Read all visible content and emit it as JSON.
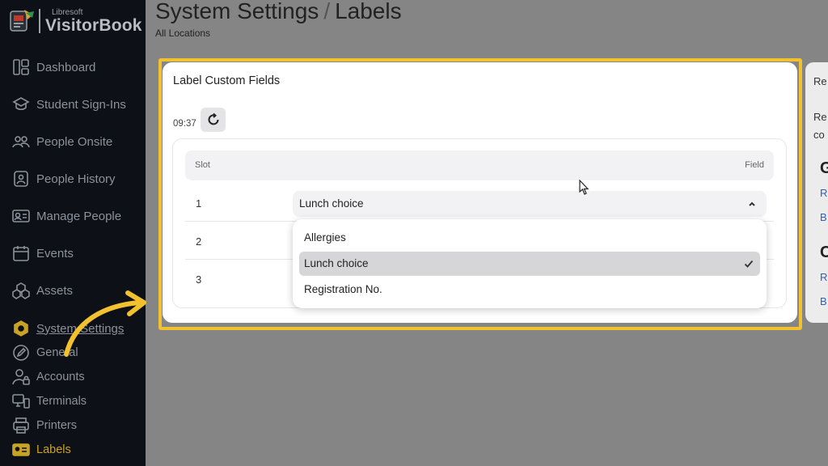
{
  "brand": {
    "small": "Libresoft",
    "name": "VisitorBook"
  },
  "sidebar": {
    "items": [
      {
        "label": "Dashboard",
        "icon": "dashboard-icon"
      },
      {
        "label": "Student Sign-Ins",
        "icon": "graduation-cap-icon"
      },
      {
        "label": "People Onsite",
        "icon": "people-icon"
      },
      {
        "label": "People History",
        "icon": "history-icon"
      },
      {
        "label": "Manage People",
        "icon": "id-card-icon"
      },
      {
        "label": "Events",
        "icon": "calendar-icon"
      },
      {
        "label": "Assets",
        "icon": "cubes-icon"
      }
    ],
    "section": {
      "label": "System Settings",
      "icon": "hexagon-icon"
    },
    "sub_items": [
      {
        "label": "General",
        "icon": "pencil-icon"
      },
      {
        "label": "Accounts",
        "icon": "user-lock-icon"
      },
      {
        "label": "Terminals",
        "icon": "terminal-icon"
      },
      {
        "label": "Printers",
        "icon": "printer-icon"
      },
      {
        "label": "Labels",
        "icon": "label-icon",
        "active": true
      }
    ]
  },
  "header": {
    "title": "System Settings",
    "separator": "/",
    "page": "Labels",
    "subtitle": "All Locations"
  },
  "card": {
    "title": "Label Custom Fields",
    "time": "09:37",
    "table": {
      "col_slot": "Slot",
      "col_field": "Field",
      "rows": [
        {
          "slot": "1"
        },
        {
          "slot": "2"
        },
        {
          "slot": "3"
        }
      ]
    },
    "select": {
      "value": "Lunch choice",
      "options": [
        "Allergies",
        "Lunch choice",
        "Registration No."
      ],
      "selected": "Lunch choice"
    }
  },
  "right_panel": {
    "t1": "Re",
    "t2": "Re",
    "t3": "co",
    "h1": "G",
    "l1": "R",
    "l2": "B",
    "h2": "C",
    "l3": "R",
    "l4": "B"
  },
  "colors": {
    "accent": "#f2c12e",
    "sidebar_bg": "#0d1016",
    "active": "#c9a325",
    "link": "#2f5fb5"
  }
}
